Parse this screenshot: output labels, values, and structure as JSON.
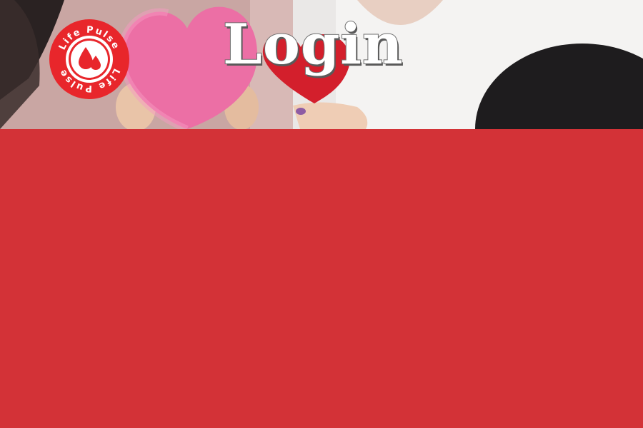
{
  "header": {
    "brand": {
      "name_top": "Life Pulse",
      "name_bottom": "Life Pulse",
      "icon": "blood-drops-icon",
      "color": "#e8262b"
    },
    "title": "Login",
    "photo_subject": "hands-holding-hearts-photo"
  },
  "main": {
    "background_color": "#d33237"
  }
}
